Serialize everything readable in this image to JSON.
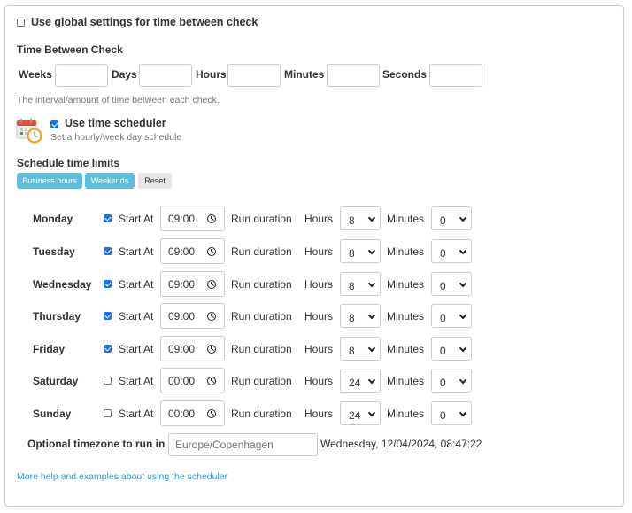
{
  "global_settings": {
    "label": "Use global settings for time between check",
    "checked": false
  },
  "time_between_check": {
    "title": "Time Between Check",
    "fields": [
      {
        "label": "Weeks",
        "value": ""
      },
      {
        "label": "Days",
        "value": ""
      },
      {
        "label": "Hours",
        "value": ""
      },
      {
        "label": "Minutes",
        "value": ""
      },
      {
        "label": "Seconds",
        "value": ""
      }
    ],
    "help": "The interval/amount of time between each check."
  },
  "scheduler": {
    "icon": "calendar-clock-icon",
    "label": "Use time scheduler",
    "checked": true,
    "subtitle": "Set a hourly/week day schedule"
  },
  "schedule_limits": {
    "title": "Schedule time limits",
    "buttons": {
      "business_hours": "Business hours",
      "weekends": "Weekends",
      "reset": "Reset"
    }
  },
  "labels": {
    "start_at": "Start At",
    "run_duration": "Run duration",
    "hours": "Hours",
    "minutes": "Minutes"
  },
  "days": [
    {
      "name": "Monday",
      "enabled": true,
      "start": "09:00",
      "hours": "8",
      "minutes": "0"
    },
    {
      "name": "Tuesday",
      "enabled": true,
      "start": "09:00",
      "hours": "8",
      "minutes": "0"
    },
    {
      "name": "Wednesday",
      "enabled": true,
      "start": "09:00",
      "hours": "8",
      "minutes": "0"
    },
    {
      "name": "Thursday",
      "enabled": true,
      "start": "09:00",
      "hours": "8",
      "minutes": "0"
    },
    {
      "name": "Friday",
      "enabled": true,
      "start": "09:00",
      "hours": "8",
      "minutes": "0"
    },
    {
      "name": "Saturday",
      "enabled": false,
      "start": "00:00",
      "hours": "24",
      "minutes": "0"
    },
    {
      "name": "Sunday",
      "enabled": false,
      "start": "00:00",
      "hours": "24",
      "minutes": "0"
    }
  ],
  "timezone": {
    "label": "Optional timezone to run in",
    "placeholder": "Europe/Copenhagen",
    "value": "",
    "current_time": "Wednesday, 12/04/2024, 08:47:22"
  },
  "help_link": "More help and examples about using the scheduler",
  "colors": {
    "accent": "#5bc0de",
    "checkbox": "#1a73e8",
    "link": "#3a9bdc",
    "clock_orange": "#f39c12",
    "calendar_red": "#e74c3c"
  }
}
